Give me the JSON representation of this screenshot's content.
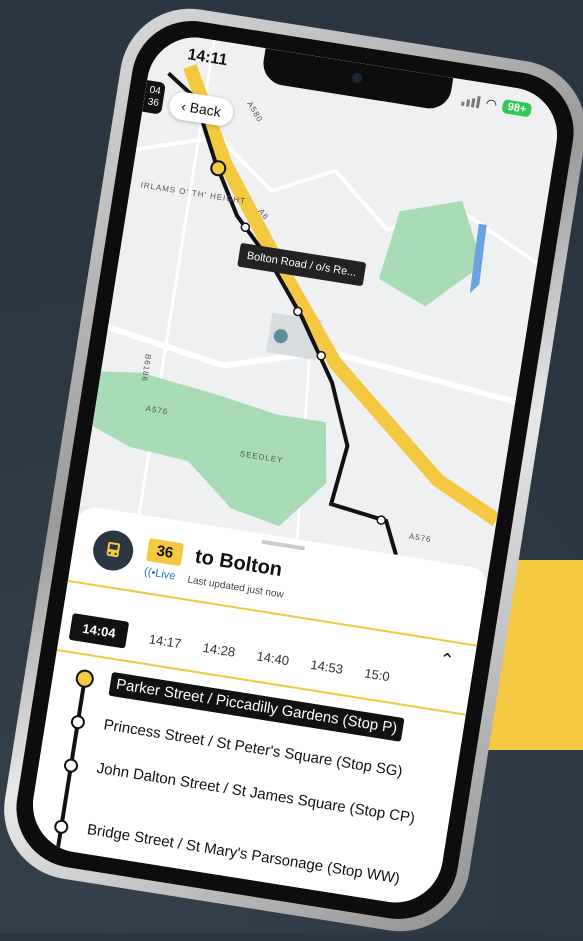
{
  "status_bar": {
    "time": "14:11",
    "battery": "98+"
  },
  "map": {
    "back_label": "Back",
    "side_badge": [
      "04",
      "36"
    ],
    "labels": {
      "irlams": "IRLAMS O' TH' HEIGHT",
      "a580": "A580",
      "a6": "A6",
      "a576": "A576",
      "a576b": "A576",
      "b6186": "B6186",
      "seedley": "SEEDLEY"
    },
    "tooltip": "Bolton Road / o/s Re..."
  },
  "panel": {
    "route_number": "36",
    "destination": "to Bolton",
    "live_label": "Live",
    "updated": "Last updated just now",
    "times": [
      "14:04",
      "14:17",
      "14:28",
      "14:40",
      "14:53",
      "15:0"
    ],
    "active_time_index": 0,
    "stops": [
      {
        "name": "Parker Street / Piccadilly Gardens (Stop P)",
        "current": true
      },
      {
        "name": "Princess Street / St Peter's Square (Stop SG)",
        "current": false
      },
      {
        "name": "John Dalton Street / St James Square (Stop CP)",
        "current": false
      },
      {
        "name": "Bridge Street / St Mary's Parsonage (Stop WW)",
        "current": false
      }
    ]
  },
  "colors": {
    "accent": "#f5c842",
    "route_line": "#111111",
    "park": "#a8dcb7",
    "live": "#1a6fd6"
  }
}
